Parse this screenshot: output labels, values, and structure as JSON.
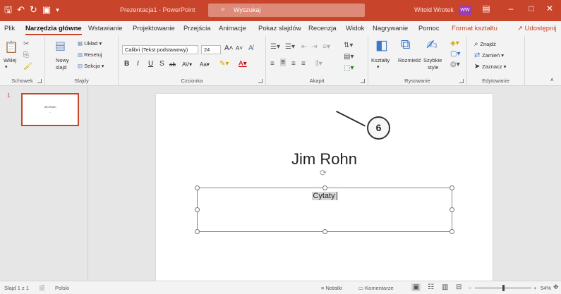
{
  "app": {
    "doc_title": "Prezentacja1 - PowerPoint",
    "search_label": "Wyszukaj",
    "user_name": "Witold Wrotek",
    "user_initials": "WW"
  },
  "tabs": [
    "Plik",
    "Narzędzia główne",
    "Wstawianie",
    "Projektowanie",
    "Przejścia",
    "Animacje",
    "Pokaz slajdów",
    "Recenzja",
    "Widok",
    "Nagrywanie",
    "Pomoc",
    "Format kształtu"
  ],
  "share_label": "Udostępnij",
  "ribbon": {
    "schowek": {
      "label": "Schowek",
      "paste": "Wklej"
    },
    "slajdy": {
      "label": "Slajdy",
      "new_slide_1": "Nowy",
      "new_slide_2": "slajd",
      "layout": "Układ",
      "reset": "Resetuj",
      "section": "Sekcja"
    },
    "czcionka": {
      "label": "Czcionka",
      "font_name": "Calibri (Tekst podstawowy)",
      "font_size": "24"
    },
    "akapit": {
      "label": "Akapit"
    },
    "rysowanie": {
      "label": "Rysowanie",
      "shapes": "Kształty",
      "arrange": "Rozmieść",
      "quick_styles_1": "Szybkie",
      "quick_styles_2": "style"
    },
    "edytowanie": {
      "label": "Edytowanie",
      "find": "Znajdź",
      "replace": "Zamień",
      "select": "Zaznacz"
    }
  },
  "thumbnail": {
    "number": "1",
    "title": "Jim Rohn"
  },
  "slide": {
    "title": "Jim Rohn",
    "subtitle": "Cytaty"
  },
  "callout": "6",
  "status": {
    "slide_info": "Slajd 1 z 1",
    "language": "Polski",
    "notes": "Notatki",
    "comments": "Komentarze",
    "zoom": "54%"
  },
  "colors": {
    "accent": "#c8442b"
  }
}
